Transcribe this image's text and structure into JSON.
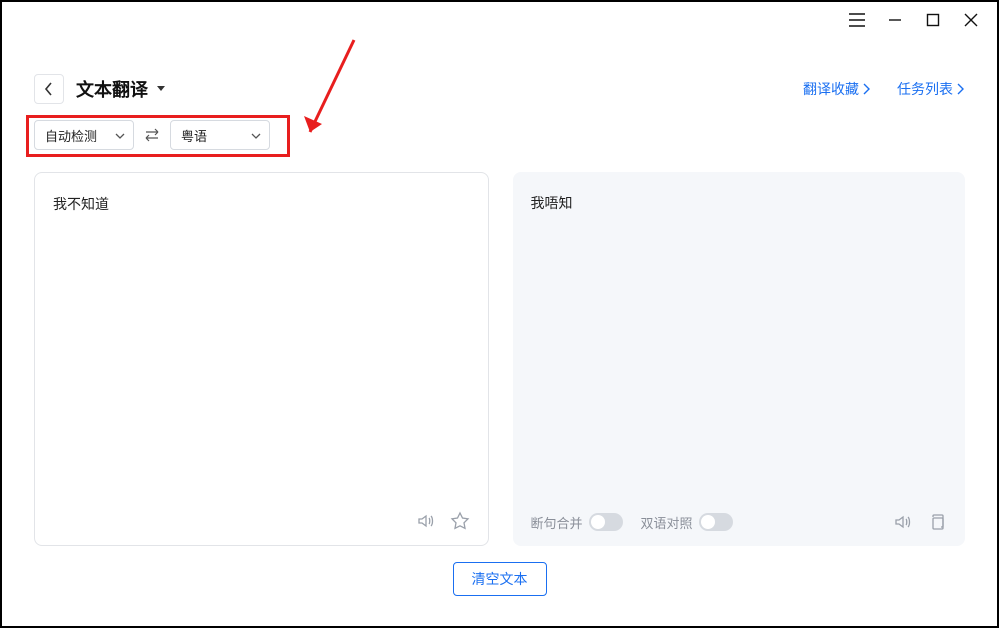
{
  "window_controls": {
    "menu": "menu",
    "minimize": "minimize",
    "maximize": "maximize",
    "close": "close"
  },
  "header": {
    "title": "文本翻译",
    "favorites_link": "翻译收藏",
    "tasks_link": "任务列表"
  },
  "language": {
    "source": "自动检测",
    "target": "粤语"
  },
  "source_pane": {
    "text": "我不知道"
  },
  "target_pane": {
    "text": "我唔知",
    "segment_merge_label": "断句合并",
    "bilingual_label": "双语对照"
  },
  "clear_button": "清空文本"
}
